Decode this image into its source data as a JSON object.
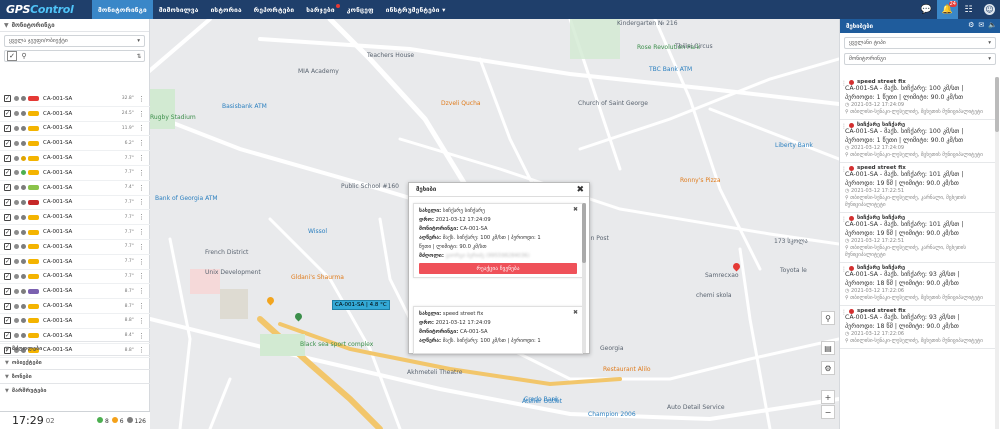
{
  "nav": {
    "logo_a": "GPS",
    "logo_b": "Control",
    "items": [
      {
        "label": "მონიტორინგი",
        "active": true
      },
      {
        "label": "მიმოხილვა"
      },
      {
        "label": "ისტორია"
      },
      {
        "label": "რეპორტები"
      },
      {
        "label": "ხარჯები",
        "dot": true
      },
      {
        "label": "კონცეფ"
      },
      {
        "label": "ინსტრუმენტები ▾"
      }
    ],
    "bell_badge": "24"
  },
  "left": {
    "monitoring_title": "მონიტორინგი",
    "filter_value": "ყველა ჯგუფი/ობიექტი",
    "vehicles": [
      {
        "plate": "CA-001-SA",
        "speed": "32.8°",
        "g1": "#8c8c8c",
        "g2": "#7d7d7d",
        "car": "#e53935"
      },
      {
        "plate": "CA-001-SA",
        "speed": "24.5°",
        "g1": "#8c8c8c",
        "g2": "#7d7d7d",
        "car": "#f4b400"
      },
      {
        "plate": "CA-001-SA",
        "speed": "11.9°",
        "g1": "#8c8c8c",
        "g2": "#7d7d7d",
        "car": "#f4b400"
      },
      {
        "plate": "CA-001-SA",
        "speed": "6.2°",
        "g1": "#8c8c8c",
        "g2": "#7d7d7d",
        "car": "#f4b400"
      },
      {
        "plate": "CA-001-SA",
        "speed": "7.7°",
        "g1": "#8c8c8c",
        "g2": "#e0a400",
        "car": "#f4b400"
      },
      {
        "plate": "CA-001-SA",
        "speed": "7.7°",
        "g1": "#8c8c8c",
        "g2": "#4caf50",
        "car": "#f4b400"
      },
      {
        "plate": "CA-001-SA",
        "speed": "7.4°",
        "g1": "#8c8c8c",
        "g2": "#7d7d7d",
        "car": "#8bc34a"
      },
      {
        "plate": "CA-001-SA",
        "speed": "7.7°",
        "g1": "#8c8c8c",
        "g2": "#7d7d7d",
        "car": "#c62828"
      },
      {
        "plate": "CA-001-SA",
        "speed": "7.7°",
        "g1": "#8c8c8c",
        "g2": "#7d7d7d",
        "car": "#f4b400"
      },
      {
        "plate": "CA-001-SA",
        "speed": "7.7°",
        "g1": "#8c8c8c",
        "g2": "#7d7d7d",
        "car": "#f4b400"
      },
      {
        "plate": "CA-001-SA",
        "speed": "7.7°",
        "g1": "#8c8c8c",
        "g2": "#7d7d7d",
        "car": "#f4b400"
      },
      {
        "plate": "CA-001-SA",
        "speed": "7.7°",
        "g1": "#8c8c8c",
        "g2": "#7d7d7d",
        "car": "#f4b400"
      },
      {
        "plate": "CA-001-SA",
        "speed": "7.7°",
        "g1": "#8c8c8c",
        "g2": "#7d7d7d",
        "car": "#f4b400"
      },
      {
        "plate": "CA-001-SA",
        "speed": "8.7°",
        "g1": "#8c8c8c",
        "g2": "#7d7d7d",
        "car": "#7b61b0"
      },
      {
        "plate": "CA-001-SA",
        "speed": "8.7°",
        "g1": "#8c8c8c",
        "g2": "#7d7d7d",
        "car": "#f4b400"
      },
      {
        "plate": "CA-001-SA",
        "speed": "8.8°",
        "g1": "#8c8c8c",
        "g2": "#7d7d7d",
        "car": "#f4b400"
      },
      {
        "plate": "CA-001-SA",
        "speed": "8.4°",
        "g1": "#8c8c8c",
        "g2": "#7d7d7d",
        "car": "#f4b400"
      },
      {
        "plate": "CA-001-SA",
        "speed": "8.8°",
        "g1": "#8c8c8c",
        "g2": "#7d7d7d",
        "car": "#f4b400"
      }
    ],
    "sections": [
      "მძღოლები",
      "ობიექტები",
      "ზონები",
      "მარშრუტები"
    ],
    "clock": {
      "time": "17:29",
      "seconds": "02"
    },
    "counts": [
      {
        "color": "#4caf50",
        "value": "8"
      },
      {
        "color": "#f4a11a",
        "value": "6"
      },
      {
        "color": "#7d7d7d",
        "value": "126"
      }
    ]
  },
  "map": {
    "labels": [
      {
        "text": "Basisbank ATM",
        "cls": "blue"
      },
      {
        "text": "Teachers House",
        "cls": ""
      },
      {
        "text": "MIA Academy",
        "cls": ""
      },
      {
        "text": "Rugby Stadium",
        "cls": "green"
      },
      {
        "text": "Dzveli Qucha",
        "cls": "orange"
      },
      {
        "text": "Church of Saint George",
        "cls": ""
      },
      {
        "text": "Kindergarten № 216",
        "cls": ""
      },
      {
        "text": "Rose Revolution Park",
        "cls": "green"
      },
      {
        "text": "TBC Bank ATM",
        "cls": "blue"
      },
      {
        "text": "Tbilisi Circus",
        "cls": ""
      },
      {
        "text": "Liberty Bank",
        "cls": "blue"
      },
      {
        "text": "Ronny's Pizza",
        "cls": "orange"
      },
      {
        "text": "Public School #160",
        "cls": ""
      },
      {
        "text": "Wissol",
        "cls": "blue"
      },
      {
        "text": "French District",
        "cls": ""
      },
      {
        "text": "Unix Development",
        "cls": ""
      },
      {
        "text": "Gldani's Shaurma",
        "cls": "orange"
      },
      {
        "text": "Black sea sport complex",
        "cls": "green"
      },
      {
        "text": "Akhmeteli Theatre",
        "cls": ""
      },
      {
        "text": "Credo Bank",
        "cls": "blue"
      },
      {
        "text": "Atelier Outlet",
        "cls": "blue"
      },
      {
        "text": "Champion 2006",
        "cls": "blue"
      },
      {
        "text": "Auto Detail Service",
        "cls": ""
      },
      {
        "text": "Restaurant Alilo",
        "cls": "orange"
      },
      {
        "text": "Samrecxao",
        "cls": ""
      },
      {
        "text": "chemi skola",
        "cls": ""
      },
      {
        "text": "Toyota le",
        "cls": ""
      },
      {
        "text": "Bank of Georgia ATM",
        "cls": "blue"
      },
      {
        "text": "173 სკოლა",
        "cls": ""
      },
      {
        "text": "Fan Post",
        "cls": ""
      },
      {
        "text": "Georgia",
        "cls": ""
      }
    ],
    "vehicle_tag": "CA-001-SA | 4.8 °C"
  },
  "popup": {
    "title": "მეხიბი",
    "cards": [
      {
        "type_label": "სახელი:",
        "type_value": "სიჩქარე სიჩქარე",
        "time_label": "დრო:",
        "time_value": "2021-03-12 17:24:09",
        "obj_label": "მონიტორინგი:",
        "obj_value": "CA-001-SA",
        "desc_label": "აღწერა:",
        "desc_value": "მაქს. სიჩქარე: 100 კმ/სთ | პერიოდი: 1",
        "desc2": "წუთი | ლიმიტი: 90.0 კმ/სთ",
        "driver_label": "მძღოლი:",
        "driver_value": "გიორგი ბერიძე (995598284036)",
        "button": "რეაქცია ჩვენება"
      },
      {
        "type_label": "სახელი:",
        "type_value": "speed street fix",
        "time_label": "დრო:",
        "time_value": "2021-03-12 17:24:09",
        "obj_label": "მონიტორინგი:",
        "obj_value": "CA-001-SA",
        "desc_label": "აღწერა:",
        "desc_value": "მაქს. სიჩქარე: 100 კმ/სთ | პერიოდი: 1"
      }
    ]
  },
  "right": {
    "title": "მეხიბები",
    "select1": "ყველანი ტიპი",
    "select2": "მონიტორინგი",
    "events": [
      {
        "title": "speed street fix",
        "line1": "CA-001-SA",
        "line1b": " - მაქს. სიჩქარე: 100 კმ/სთ |",
        "line2": "პერიოდი: 1 წუთი | ლიმიტი: 90.0 კმ/სთ",
        "time": "2021-03-12 17:24:09",
        "addr": "თბილისი-სენაკი-ლესელიძე, მცხეთის მუნიციპალიტეტი"
      },
      {
        "title": "სიჩქარე სიჩქარე",
        "line1": "CA-001-SA",
        "line1b": " - მაქს. სიჩქარე: 100 კმ/სთ |",
        "line2": "პერიოდი: 1 წუთი | ლიმიტი: 90.0 კმ/სთ",
        "time": "2021-03-12 17:24:09",
        "addr": "თბილისი-სენაკი-ლესელიძე, მცხეთის მუნიციპალიტეტი"
      },
      {
        "title": "speed street fix",
        "line1": "CA-001-SA",
        "line1b": " - მაქს. სიჩქარე: 101 კმ/სთ |",
        "line2": "პერიოდი: 19 წმ | ლიმიტი: 90.0 კმ/სთ",
        "time": "2021-03-12 17:22:51",
        "addr": "თბილისი-სენაკი-ლესელიძე, კარნალი, მცხეთის მუნიციპალიტეტი"
      },
      {
        "title": "სიჩქარე სიჩქარე",
        "line1": "CA-001-SA",
        "line1b": " - მაქს. სიჩქარე: 101 კმ/სთ |",
        "line2": "პერიოდი: 19 წმ | ლიმიტი: 90.0 კმ/სთ",
        "time": "2021-03-12 17:22:51",
        "addr": "თბილისი-სენაკი-ლესელიძე, კარნალი, მცხეთის მუნიციპალიტეტი"
      },
      {
        "title": "სიჩქარე სიჩქარე",
        "line1": "CA-001-SA",
        "line1b": " - მაქს. სიჩქარე: 93 კმ/სთ |",
        "line2": "პერიოდი: 18 წმ | ლიმიტი: 90.0 კმ/სთ",
        "time": "2021-03-12 17:22:06",
        "addr": "თბილისი-სენაკი-ლესელიძე, მცხეთის მუნიციპალიტეტი"
      },
      {
        "title": "speed street fix",
        "line1": "CA-001-SA",
        "line1b": " - მაქს. სიჩქარე: 93 კმ/სთ |",
        "line2": "პერიოდი: 18 წმ | ლიმიტი: 90.0 კმ/სთ",
        "time": "2021-03-12 17:22:06",
        "addr": "თბილისი-სენაკი-ლესელიძე, მცხეთის მუნიციპალიტეტი"
      }
    ]
  }
}
